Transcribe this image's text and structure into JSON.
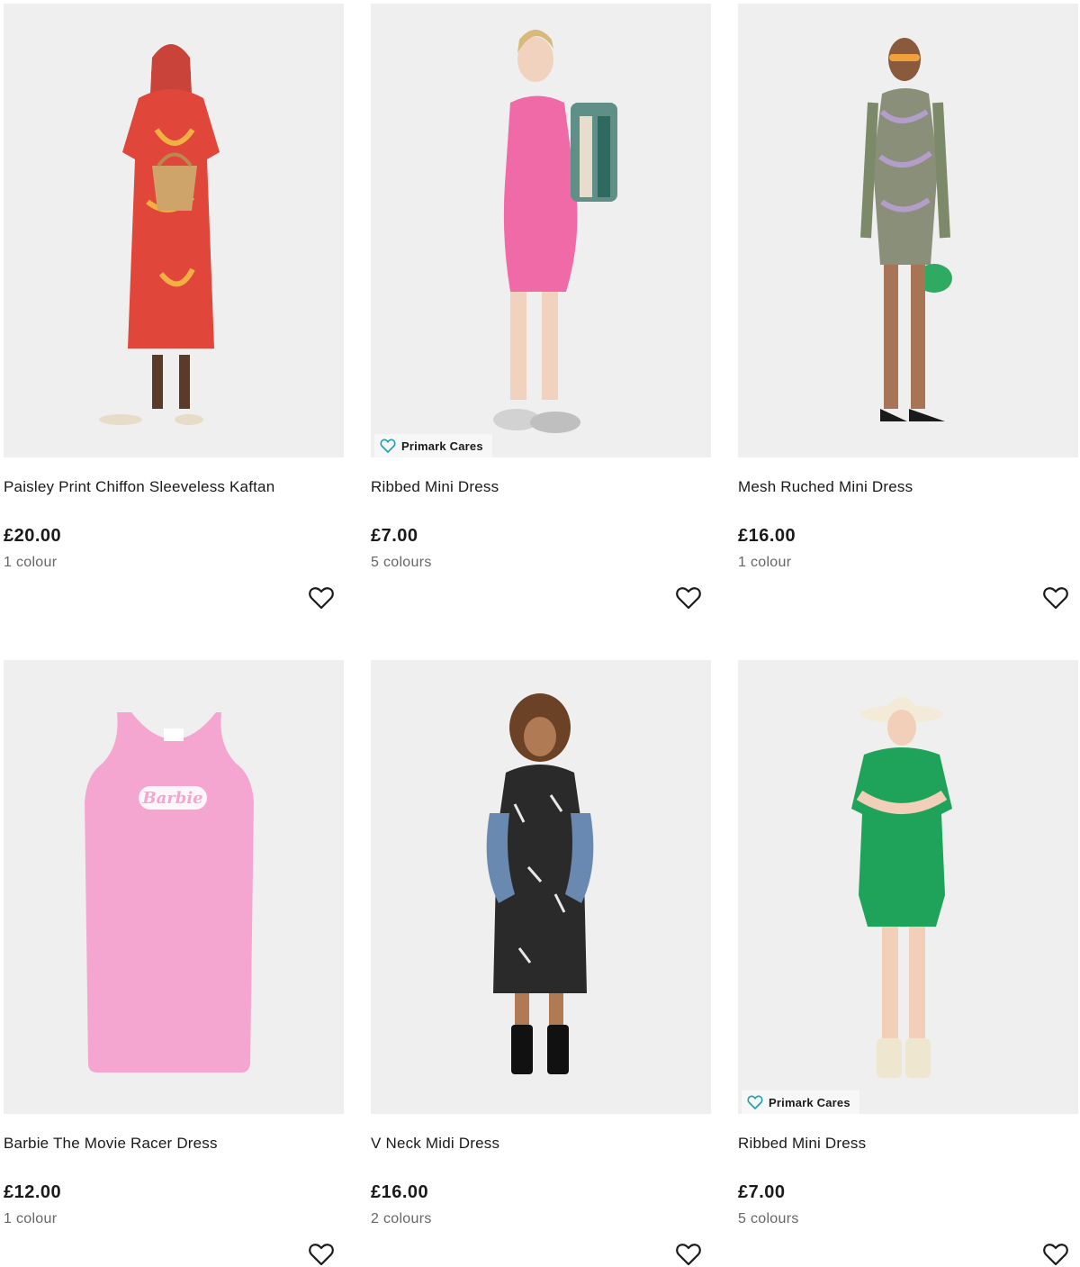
{
  "colors": {
    "image_bg": "#efefef",
    "text": "#1a1a1a",
    "muted": "#666666",
    "badge_icon": "#1aa0b0"
  },
  "products": [
    {
      "title": "Paisley Print Chiffon Sleeveless Kaftan",
      "price": "£20.00",
      "colours": "1 colour",
      "badge": null,
      "image": "model-red-paisley-kaftan-straw-basket",
      "garment_color": "#e0463a"
    },
    {
      "title": "Ribbed Mini Dress",
      "price": "£7.00",
      "colours": "5 colours",
      "badge": "Primark Cares",
      "image": "model-pink-ribbed-mini-dress-check-tote",
      "garment_color": "#f06aa8"
    },
    {
      "title": "Mesh Ruched Mini Dress",
      "price": "£16.00",
      "colours": "1 colour",
      "badge": null,
      "image": "model-tie-dye-mesh-mini-dress-green-bag",
      "garment_color": "#8a8f7a"
    },
    {
      "title": "Barbie The Movie Racer Dress",
      "price": "£12.00",
      "colours": "1 colour",
      "badge": null,
      "image": "flat-pink-barbie-racer-dress",
      "garment_color": "#f5a6d0",
      "print": "Barbie"
    },
    {
      "title": "V Neck Midi Dress",
      "price": "£16.00",
      "colours": "2 colours",
      "badge": null,
      "image": "model-black-floral-v-neck-midi-denim-jacket",
      "garment_color": "#2a2a2a"
    },
    {
      "title": "Ribbed Mini Dress",
      "price": "£7.00",
      "colours": "5 colours",
      "badge": "Primark Cares",
      "image": "model-green-ribbed-mini-dress-sun-hat",
      "garment_color": "#1fa35a"
    }
  ]
}
